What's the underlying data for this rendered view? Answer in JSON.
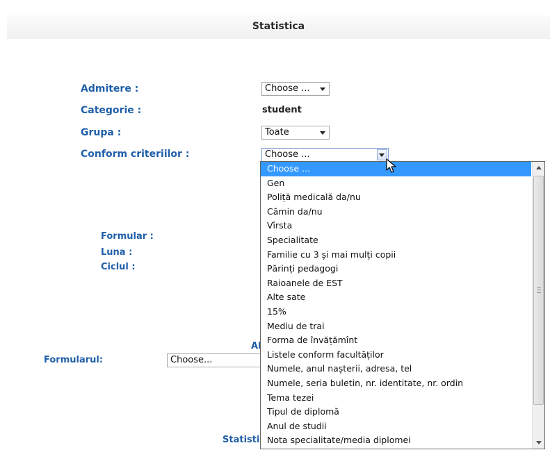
{
  "page": {
    "title": "Statistica"
  },
  "form": {
    "admitere": {
      "label": "Admitere :",
      "value": "Choose ..."
    },
    "categorie": {
      "label": "Categorie :",
      "value": "student"
    },
    "grupa": {
      "label": "Grupa :",
      "value": "Toate"
    },
    "criterii": {
      "label": "Conform criteriilor :",
      "value": "Choose ..."
    },
    "formular": {
      "label": "Formular :"
    },
    "luna": {
      "label": "Luna :"
    },
    "ciclul": {
      "label": "Ciclul :"
    },
    "partial_heading": "Al",
    "formularul": {
      "label": "Formularul:",
      "value": "Choose..."
    },
    "partial_footer": "Statisti"
  },
  "dropdown": {
    "options": [
      "Choose ...",
      "Gen",
      "Poliță medicală da/nu",
      "Cămin da/nu",
      "Vîrsta",
      "Specialitate",
      "Familie cu 3 și mai mulți copii",
      "Părinți pedagogi",
      "Raioanele de EST",
      "Alte sate",
      "15%",
      "Mediu de trai",
      "Forma de învățămînt",
      "Listele conform facultăților",
      "Numele, anul nașterii, adresa, tel",
      "Numele, seria buletin, nr. identitate, nr. ordin",
      "Tema tezei",
      "Tipul de diplomă",
      "Anul de studii",
      "Nota specialitate/media diplomei"
    ],
    "selected_index": 0
  },
  "colors": {
    "label_blue": "#1f5fa8",
    "selection": "#3399ff"
  },
  "icons": {
    "cursor": "mouse-pointer-icon",
    "dropdown_arrow": "chevron-down-icon"
  }
}
